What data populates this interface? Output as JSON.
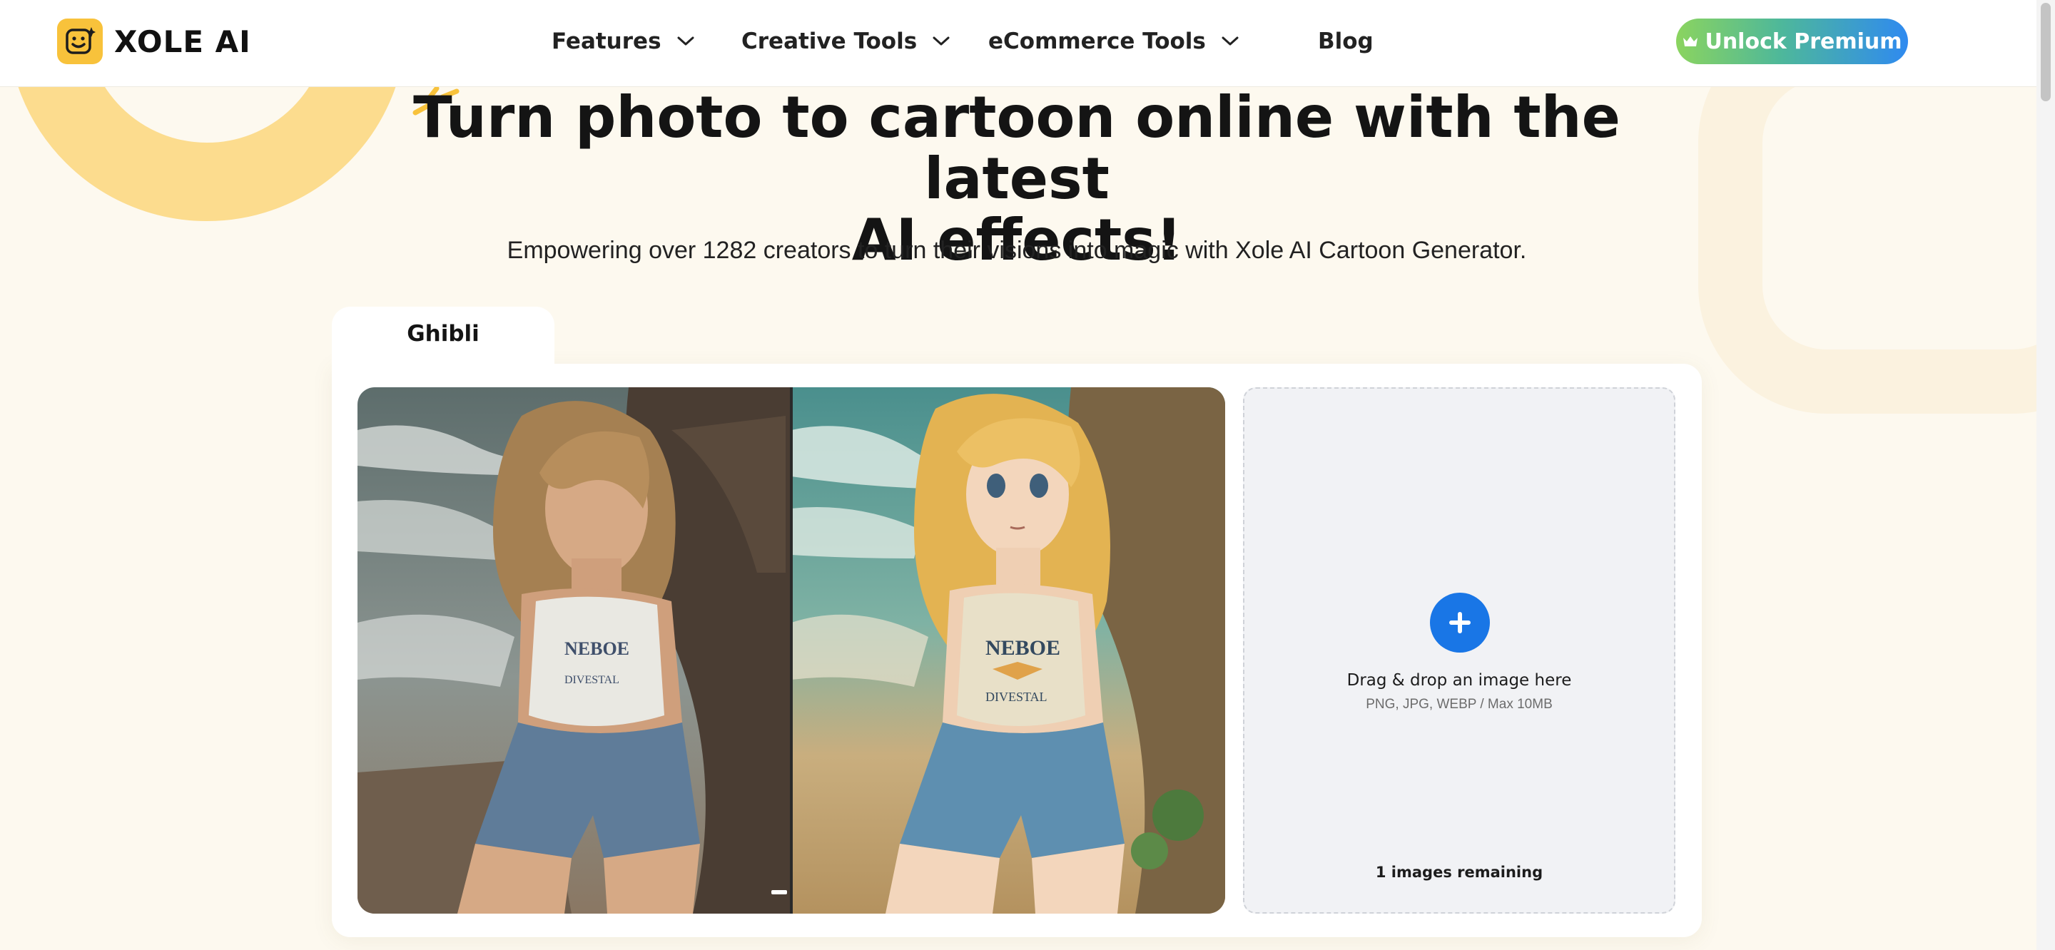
{
  "brand": {
    "name": "XOLE AI"
  },
  "nav": {
    "features": "Features",
    "creative_tools": "Creative Tools",
    "ecommerce_tools": "eCommerce Tools",
    "blog": "Blog"
  },
  "premium": {
    "label": "Unlock Premium"
  },
  "hero": {
    "title_line1": "Turn photo to cartoon online with the latest",
    "title_line2": "AI effects!",
    "subtitle": "Empowering over 1282 creators to turn their visions into magic with Xole AI Cartoon Generator."
  },
  "tool": {
    "active_tab": "Ghibli",
    "compare": {
      "before_shirt_line1": "NEBOE",
      "before_shirt_line2": "DIVESTAL",
      "after_shirt_line1": "NEBOE",
      "after_shirt_line2": "DIVESTAL",
      "divider_position": 0.5
    },
    "upload": {
      "title": "Drag & drop an image here",
      "hint": "PNG, JPG, WEBP / Max 10MB",
      "remaining": "1 images remaining"
    }
  },
  "colors": {
    "page_bg": "#fdf9ef",
    "logo_yellow": "#f8c23b",
    "accent_blue": "#1976e6",
    "premium_gradient_start": "#8bd45f",
    "premium_gradient_end": "#2f8af0"
  },
  "icons": {
    "logo": "smiley-face-icon",
    "nav_dropdown": "chevron-down-icon",
    "premium": "crown-icon",
    "upload": "plus-icon"
  }
}
